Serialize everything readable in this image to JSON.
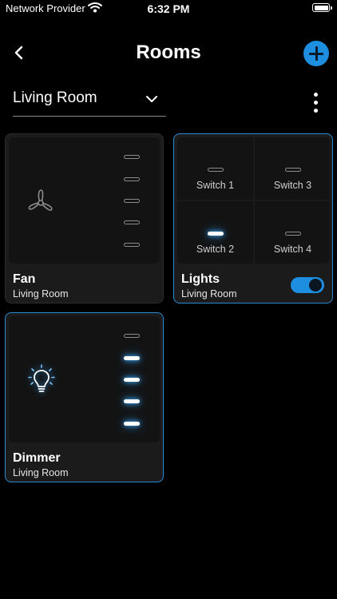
{
  "status_bar": {
    "carrier": "Network Provider",
    "time": "6:32 PM"
  },
  "header": {
    "title": "Rooms"
  },
  "room_selector": {
    "value": "Living Room"
  },
  "colors": {
    "accent": "#1e8fe0",
    "card_bg": "#1b1b1b",
    "glow": "#3ba9ff"
  },
  "devices": {
    "fan": {
      "name": "Fan",
      "room": "Living Room",
      "icon": "fan-icon",
      "levels_on": [
        false,
        false,
        false,
        false,
        false
      ]
    },
    "lights": {
      "name": "Lights",
      "room": "Living Room",
      "power_on": true,
      "switches": [
        {
          "label": "Switch 1",
          "on": false
        },
        {
          "label": "Switch 3",
          "on": false
        },
        {
          "label": "Switch 2",
          "on": true
        },
        {
          "label": "Switch 4",
          "on": false
        }
      ]
    },
    "dimmer": {
      "name": "Dimmer",
      "room": "Living Room",
      "icon": "lightbulb-icon",
      "levels_on": [
        false,
        true,
        true,
        true,
        true
      ]
    }
  }
}
